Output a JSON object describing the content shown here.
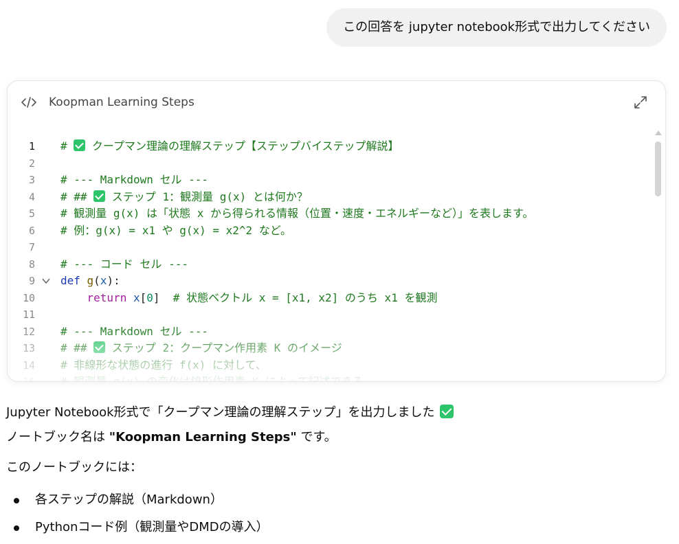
{
  "user_message": "この回答を jupyter notebook形式で出力してください",
  "canvas": {
    "title": "Koopman Learning Steps",
    "lines": [
      {
        "n": "1",
        "t": [
          {
            "c": "cm",
            "v": "# "
          },
          {
            "c": "check"
          },
          {
            "c": "cm",
            "v": " クープマン理論の理解ステップ【ステップバイステップ解説】"
          }
        ]
      },
      {
        "n": "2",
        "t": []
      },
      {
        "n": "3",
        "t": [
          {
            "c": "cm",
            "v": "# --- Markdown セル ---"
          }
        ]
      },
      {
        "n": "4",
        "t": [
          {
            "c": "cm",
            "v": "# ## "
          },
          {
            "c": "check"
          },
          {
            "c": "cm",
            "v": " ステップ 1：観測量 g(x) とは何か？"
          }
        ]
      },
      {
        "n": "5",
        "t": [
          {
            "c": "cm",
            "v": "# 観測量 g(x) は「状態 x から得られる情報（位置・速度・エネルギーなど）」を表します。"
          }
        ]
      },
      {
        "n": "6",
        "t": [
          {
            "c": "cm",
            "v": "# 例：g(x) = x1 や g(x) = x2^2 など。"
          }
        ]
      },
      {
        "n": "7",
        "t": []
      },
      {
        "n": "8",
        "t": [
          {
            "c": "cm",
            "v": "# --- コード セル ---"
          }
        ]
      },
      {
        "n": "9",
        "fold": true,
        "t": [
          {
            "c": "kw",
            "v": "def "
          },
          {
            "c": "fn",
            "v": "g"
          },
          {
            "c": "pl",
            "v": "("
          },
          {
            "c": "var",
            "v": "x"
          },
          {
            "c": "pl",
            "v": "):"
          }
        ]
      },
      {
        "n": "10",
        "t": [
          {
            "c": "pl",
            "v": "    "
          },
          {
            "c": "kw2",
            "v": "return "
          },
          {
            "c": "var",
            "v": "x"
          },
          {
            "c": "pl",
            "v": "["
          },
          {
            "c": "num",
            "v": "0"
          },
          {
            "c": "pl",
            "v": "]  "
          },
          {
            "c": "cm",
            "v": "# 状態ベクトル x = [x1, x2] のうち x1 を観測"
          }
        ]
      },
      {
        "n": "11",
        "t": []
      },
      {
        "n": "12",
        "t": [
          {
            "c": "cm",
            "v": "# --- Markdown セル ---"
          }
        ]
      },
      {
        "n": "13",
        "t": [
          {
            "c": "cm",
            "v": "# ## "
          },
          {
            "c": "check"
          },
          {
            "c": "cm",
            "v": " ステップ 2：クープマン作用素 K のイメージ"
          }
        ]
      },
      {
        "n": "14",
        "t": [
          {
            "c": "cm",
            "v": "# 非線形な状態の進行 f(x) に対して、"
          }
        ]
      },
      {
        "n": "15",
        "t": [
          {
            "c": "cm",
            "v": "# 観測量 g(x) の変化は線形作用素 K によって記述できる"
          }
        ]
      }
    ]
  },
  "answer": {
    "line1": "Jupyter Notebook形式で「クープマン理論の理解ステップ」を出力しました",
    "line2_prefix": "ノートブック名は ",
    "line2_name": "\"Koopman Learning Steps\"",
    "line2_suffix": " です。",
    "line3": "このノートブックには：",
    "bullets": [
      "各ステップの解説（Markdown）",
      "Pythonコード例（観測量やDMDの導入）"
    ]
  }
}
